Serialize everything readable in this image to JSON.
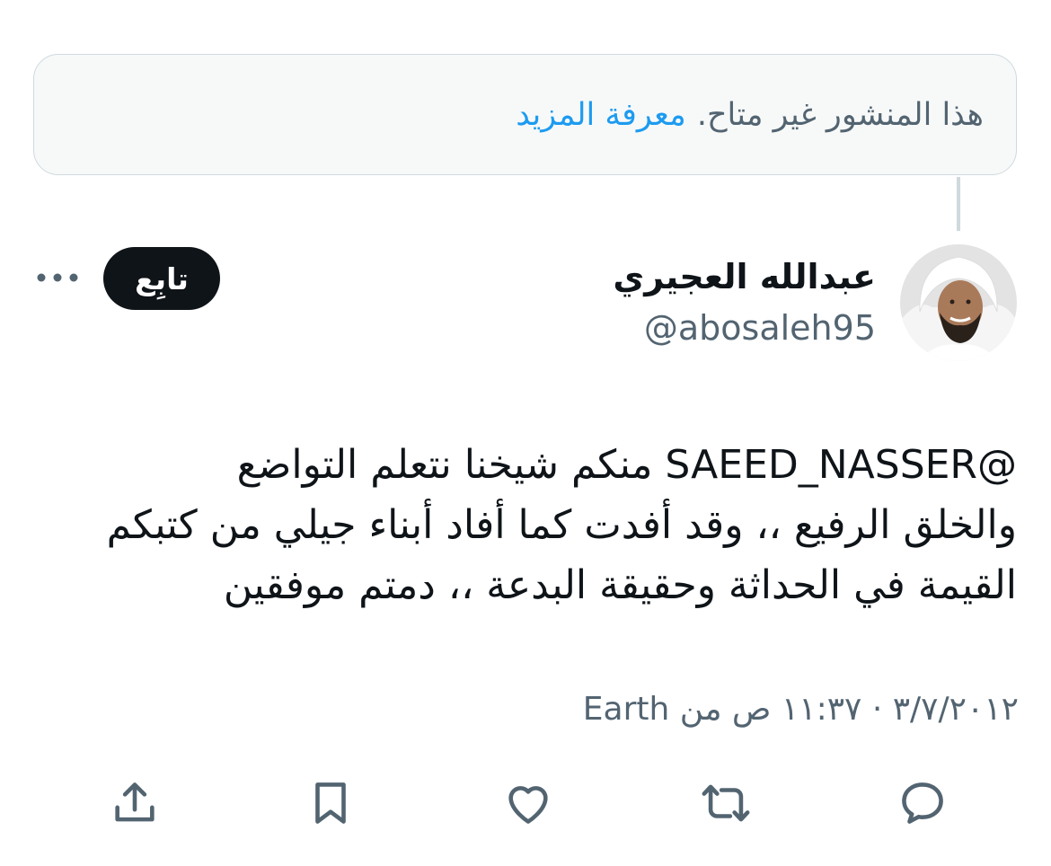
{
  "notice": {
    "text": "هذا المنشور غير متاح.",
    "link": "معرفة المزيد"
  },
  "author": {
    "display_name": "عبدالله العجيري",
    "handle": "@abosaleh95"
  },
  "follow_label": "تابِع",
  "tweet": {
    "lines": [
      "@SAEED_NASSER منكم شيخنا نتعلم التواضع",
      "والخلق الرفيع ،، وقد أفدت كما أفاد أبناء جيلي من كتبكم",
      "القيمة في الحداثة وحقيقة البدعة ،، دمتم موفقين"
    ]
  },
  "meta": "٣/٧/٢٠١٢ · ١١:٣٧ ص من Earth",
  "actions": [
    "reply-icon",
    "retweet-icon",
    "like-icon",
    "bookmark-icon",
    "share-icon"
  ],
  "colors": {
    "link": "#1d9bf0",
    "secondary_text": "#536471",
    "border": "#cfd9de",
    "follow_button_bg": "#0f1419"
  }
}
